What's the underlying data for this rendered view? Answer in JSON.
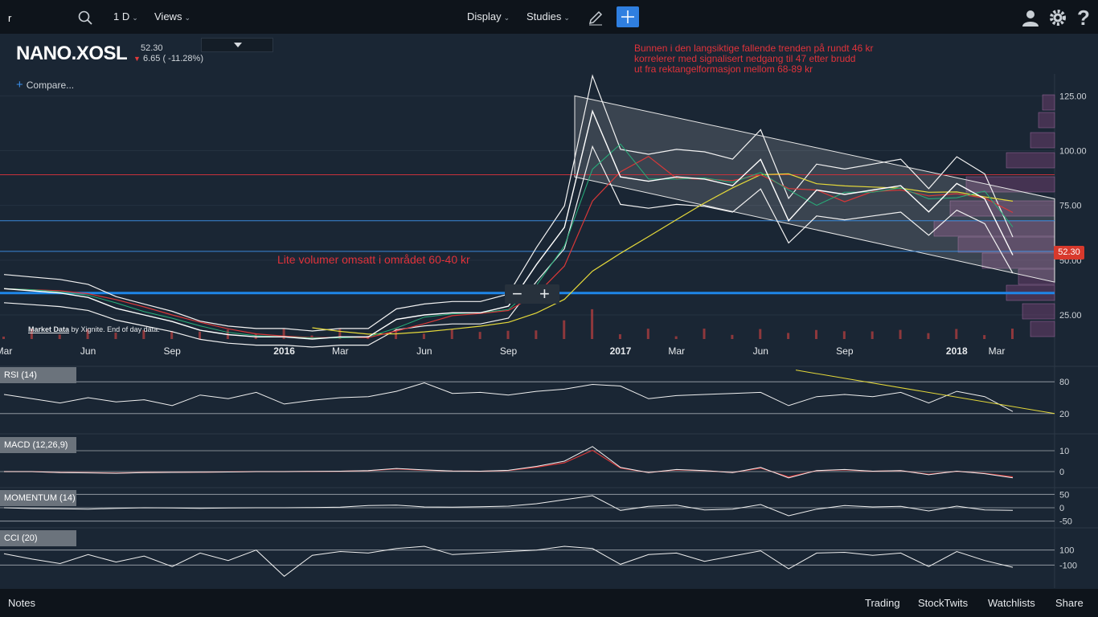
{
  "toolbar": {
    "search_value": "r",
    "interval": "1 D",
    "views": "Views",
    "display": "Display",
    "studies": "Studies"
  },
  "header": {
    "symbol": "NANO.XOSL",
    "last_price": "52.30",
    "change": "6.65 ( -11.28%)",
    "compare": "Compare..."
  },
  "annotations": {
    "note_top": [
      "Bunnen i den langsiktige fallende trenden på rundt 46 kr",
      "korrelerer med signalisert nedgang til 47 etter brudd",
      "ut fra rektangelformasjon mellom 68-89 kr"
    ],
    "note_volume": "Lite volumer omsatt i området 60-40 kr",
    "credit_link": "Market Data",
    "credit_rest": "by Xignite.  End of day data."
  },
  "bottom": {
    "notes": "Notes",
    "trading": "Trading",
    "stocktwits": "StockTwits",
    "watchlists": "Watchlists",
    "share": "Share"
  },
  "chart_data": [
    {
      "type": "line",
      "name_panel": "price",
      "x": [
        "2015-03",
        "2015-04",
        "2015-05",
        "2015-06",
        "2015-07",
        "2015-08",
        "2015-09",
        "2015-10",
        "2015-11",
        "2015-12",
        "2016-01",
        "2016-02",
        "2016-03",
        "2016-04",
        "2016-05",
        "2016-06",
        "2016-07",
        "2016-08",
        "2016-09",
        "2016-10",
        "2016-11",
        "2016-12",
        "2017-01",
        "2017-02",
        "2017-03",
        "2017-04",
        "2017-05",
        "2017-06",
        "2017-07",
        "2017-08",
        "2017-09",
        "2017-10",
        "2017-11",
        "2017-12",
        "2018-01",
        "2018-02",
        "2018-03"
      ],
      "close": [
        37,
        36,
        35,
        33,
        28,
        25,
        22,
        18,
        16,
        15,
        15,
        14,
        15,
        15,
        23,
        25,
        26,
        26,
        29,
        48,
        65,
        118,
        88,
        86,
        88,
        87,
        84,
        96,
        68,
        82,
        80,
        82,
        84,
        72,
        85,
        78,
        52.3
      ],
      "y_ticks": [
        25,
        50,
        75,
        100,
        125
      ],
      "ylim": [
        14,
        135
      ],
      "x_tick_labels": [
        "Mar",
        "Jun",
        "Sep",
        "2016",
        "Mar",
        "Jun",
        "Sep",
        "2017",
        "Mar",
        "Jun",
        "Sep",
        "2018",
        "Mar"
      ],
      "last_label": "52.30",
      "horizontal_levels": [
        {
          "value": 89,
          "color": "#c8323b"
        },
        {
          "value": 68,
          "color": "#3b88d8"
        },
        {
          "value": 54,
          "color": "#3b88d8"
        },
        {
          "value": 35,
          "color": "#1e86e8"
        }
      ],
      "colors": {
        "price": "#ffffff",
        "ma_long": "#e5d93a",
        "ma_mid": "#d83838",
        "ma_short": "#27b07a",
        "channel": "#e8e8e8",
        "volume": "#c04040"
      }
    },
    {
      "type": "line",
      "name_panel": "rsi",
      "title": "RSI (14)",
      "y_ticks": [
        20,
        80
      ],
      "ylim": [
        0,
        100
      ],
      "values": [
        56,
        48,
        40,
        50,
        42,
        46,
        35,
        55,
        48,
        60,
        38,
        45,
        50,
        52,
        62,
        78,
        58,
        60,
        55,
        62,
        66,
        75,
        72,
        48,
        54,
        56,
        58,
        60,
        35,
        52,
        56,
        52,
        60,
        40,
        62,
        52,
        24
      ]
    },
    {
      "type": "line",
      "name_panel": "macd",
      "title": "MACD (12,26,9)",
      "y_ticks": [
        10,
        0
      ],
      "ylim": [
        -5,
        15
      ],
      "values": [
        0,
        0,
        -0.5,
        -0.6,
        -0.8,
        -0.5,
        -0.4,
        -0.3,
        -0.2,
        0,
        0,
        0.1,
        0.2,
        0.5,
        1.5,
        0.8,
        0.3,
        0.2,
        0.6,
        2.5,
        5,
        12,
        2,
        -0.5,
        1,
        0.5,
        -0.5,
        2,
        -3,
        0.5,
        1,
        0.2,
        0.5,
        -1.5,
        0.2,
        -1,
        -3
      ]
    },
    {
      "type": "line",
      "name_panel": "momentum",
      "title": "MOMENTUM (14)",
      "y_ticks": [
        50,
        0,
        -50
      ],
      "ylim": [
        -60,
        60
      ],
      "values": [
        0,
        -3,
        -4,
        -5,
        -2,
        0,
        -1,
        -2,
        -1,
        0,
        0,
        1,
        2,
        8,
        10,
        3,
        2,
        4,
        6,
        15,
        30,
        45,
        -10,
        5,
        10,
        -8,
        -5,
        12,
        -30,
        -5,
        8,
        3,
        5,
        -12,
        6,
        -8,
        -10
      ]
    },
    {
      "type": "line",
      "name_panel": "cci",
      "title": "CCI (20)",
      "y_ticks": [
        100,
        -100
      ],
      "ylim": [
        -300,
        300
      ],
      "values": [
        50,
        -20,
        -80,
        40,
        -60,
        20,
        -120,
        60,
        -40,
        100,
        -250,
        30,
        80,
        60,
        120,
        150,
        40,
        60,
        80,
        100,
        150,
        120,
        -90,
        40,
        60,
        -50,
        20,
        90,
        -150,
        60,
        70,
        30,
        60,
        -120,
        80,
        -40,
        -130
      ]
    }
  ]
}
